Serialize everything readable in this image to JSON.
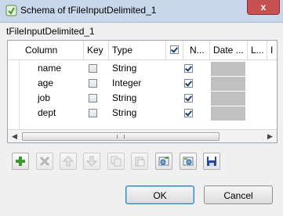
{
  "window": {
    "title": "Schema of tFileInputDelimited_1",
    "close_glyph": "x"
  },
  "component_name": "tFileInputDelimited_1",
  "table": {
    "headers": [
      "Column",
      "Key",
      "Type",
      "",
      "N...",
      "Date ...",
      "L...",
      "I"
    ],
    "rows": [
      {
        "column": "name",
        "key": false,
        "type": "String",
        "nullable": true
      },
      {
        "column": "age",
        "key": false,
        "type": "Integer",
        "nullable": true
      },
      {
        "column": "job",
        "key": false,
        "type": "String",
        "nullable": true
      },
      {
        "column": "dept",
        "key": false,
        "type": "String",
        "nullable": true
      }
    ]
  },
  "toolbar": {
    "buttons": [
      {
        "icon": "add-icon",
        "enabled": true
      },
      {
        "icon": "delete-icon",
        "enabled": false
      },
      {
        "icon": "move-up-icon",
        "enabled": false
      },
      {
        "icon": "move-down-icon",
        "enabled": false
      },
      {
        "icon": "copy-icon",
        "enabled": false
      },
      {
        "icon": "paste-icon",
        "enabled": false
      },
      {
        "icon": "import-schema-icon",
        "enabled": true
      },
      {
        "icon": "export-schema-icon",
        "enabled": true
      },
      {
        "icon": "save-icon",
        "enabled": true
      }
    ]
  },
  "actions": {
    "ok_label": "OK",
    "cancel_label": "Cancel"
  },
  "colors": {
    "title_bar": "#c9d7ea",
    "close_button": "#c75050",
    "add_icon": "#3a9a2a",
    "save_icon": "#2446a8"
  }
}
